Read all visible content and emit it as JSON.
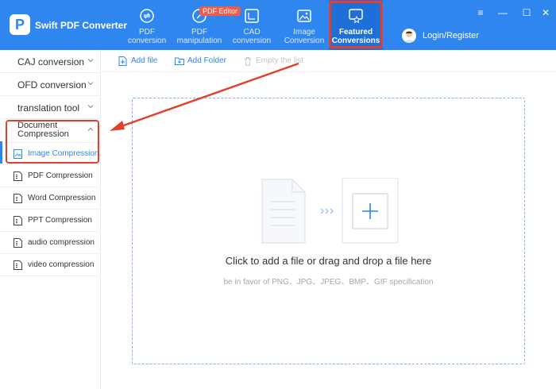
{
  "app": {
    "title": "Swift PDF Converter",
    "logo_letter": "P"
  },
  "nav": [
    {
      "label": "PDF\nconversion",
      "icon": "pdf-conversion-icon"
    },
    {
      "label": "PDF\nmanipulation",
      "icon": "pdf-manipulation-icon"
    },
    {
      "label": "CAD\nconversion",
      "icon": "cad-conversion-icon"
    },
    {
      "label": "Image\nConversion",
      "icon": "image-conversion-icon"
    },
    {
      "label": "Featured\nConversions",
      "icon": "featured-conversions-icon"
    }
  ],
  "badge": {
    "text": "PDF Editor"
  },
  "user": {
    "login": "Login/Register"
  },
  "window": {
    "menu": "≡",
    "minimize": "—",
    "maximize": "☐",
    "close": "✕"
  },
  "sidebar": {
    "categories": [
      {
        "label": "CAJ conversion"
      },
      {
        "label": "OFD conversion"
      },
      {
        "label": "translation tool"
      },
      {
        "label": "Document Compression"
      }
    ],
    "subitems": [
      {
        "label": "Image Compression"
      },
      {
        "label": "PDF Compression"
      },
      {
        "label": "Word Compression"
      },
      {
        "label": "PPT Compression"
      },
      {
        "label": "audio compression"
      },
      {
        "label": "video compression"
      }
    ]
  },
  "toolbar": {
    "add_file": "Add file",
    "add_folder": "Add Folder",
    "empty_list": "Empty the list"
  },
  "dropzone": {
    "main": "Click to add a file or drag and drop a file here",
    "sub": "be in favor of PNG、JPG、JPEG、BMP、GIF specification"
  },
  "colors": {
    "brand": "#2f86ef",
    "highlight": "#e2402d",
    "badge": "#f25a4a"
  }
}
